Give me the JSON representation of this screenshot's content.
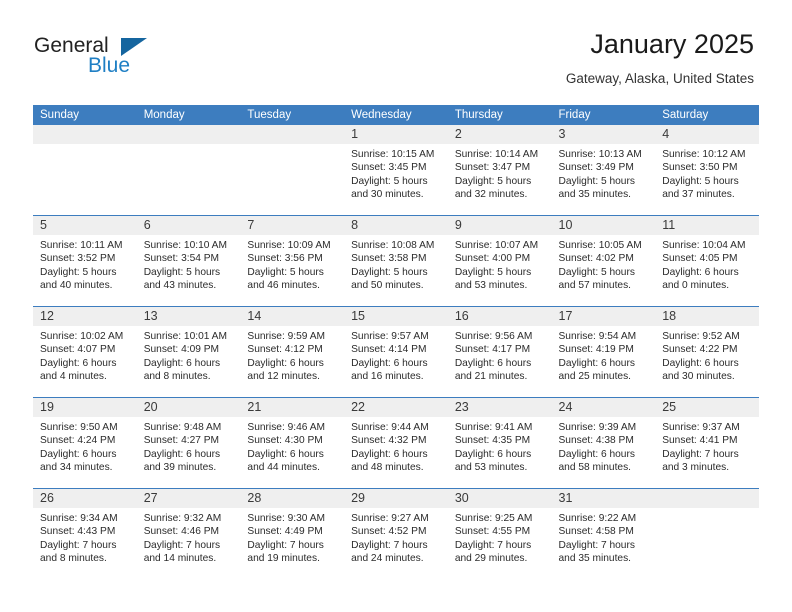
{
  "brand": {
    "line1": "General",
    "line2": "Blue",
    "triangle_color": "#15659f",
    "accent_color": "#1f7fc4"
  },
  "header": {
    "title": "January 2025",
    "subtitle": "Gateway, Alaska, United States"
  },
  "theme": {
    "header_row_bg": "#3d7dbf",
    "daynum_band_bg": "#efefef",
    "rule_color": "#3d7dbf"
  },
  "calendar": {
    "weekday_headers": [
      "Sunday",
      "Monday",
      "Tuesday",
      "Wednesday",
      "Thursday",
      "Friday",
      "Saturday"
    ],
    "weeks": [
      [
        {
          "day": "",
          "sunrise": "",
          "sunset": "",
          "daylight_line1": "",
          "daylight_line2": ""
        },
        {
          "day": "",
          "sunrise": "",
          "sunset": "",
          "daylight_line1": "",
          "daylight_line2": ""
        },
        {
          "day": "",
          "sunrise": "",
          "sunset": "",
          "daylight_line1": "",
          "daylight_line2": ""
        },
        {
          "day": "1",
          "sunrise": "Sunrise: 10:15 AM",
          "sunset": "Sunset: 3:45 PM",
          "daylight_line1": "Daylight: 5 hours",
          "daylight_line2": "and 30 minutes."
        },
        {
          "day": "2",
          "sunrise": "Sunrise: 10:14 AM",
          "sunset": "Sunset: 3:47 PM",
          "daylight_line1": "Daylight: 5 hours",
          "daylight_line2": "and 32 minutes."
        },
        {
          "day": "3",
          "sunrise": "Sunrise: 10:13 AM",
          "sunset": "Sunset: 3:49 PM",
          "daylight_line1": "Daylight: 5 hours",
          "daylight_line2": "and 35 minutes."
        },
        {
          "day": "4",
          "sunrise": "Sunrise: 10:12 AM",
          "sunset": "Sunset: 3:50 PM",
          "daylight_line1": "Daylight: 5 hours",
          "daylight_line2": "and 37 minutes."
        }
      ],
      [
        {
          "day": "5",
          "sunrise": "Sunrise: 10:11 AM",
          "sunset": "Sunset: 3:52 PM",
          "daylight_line1": "Daylight: 5 hours",
          "daylight_line2": "and 40 minutes."
        },
        {
          "day": "6",
          "sunrise": "Sunrise: 10:10 AM",
          "sunset": "Sunset: 3:54 PM",
          "daylight_line1": "Daylight: 5 hours",
          "daylight_line2": "and 43 minutes."
        },
        {
          "day": "7",
          "sunrise": "Sunrise: 10:09 AM",
          "sunset": "Sunset: 3:56 PM",
          "daylight_line1": "Daylight: 5 hours",
          "daylight_line2": "and 46 minutes."
        },
        {
          "day": "8",
          "sunrise": "Sunrise: 10:08 AM",
          "sunset": "Sunset: 3:58 PM",
          "daylight_line1": "Daylight: 5 hours",
          "daylight_line2": "and 50 minutes."
        },
        {
          "day": "9",
          "sunrise": "Sunrise: 10:07 AM",
          "sunset": "Sunset: 4:00 PM",
          "daylight_line1": "Daylight: 5 hours",
          "daylight_line2": "and 53 minutes."
        },
        {
          "day": "10",
          "sunrise": "Sunrise: 10:05 AM",
          "sunset": "Sunset: 4:02 PM",
          "daylight_line1": "Daylight: 5 hours",
          "daylight_line2": "and 57 minutes."
        },
        {
          "day": "11",
          "sunrise": "Sunrise: 10:04 AM",
          "sunset": "Sunset: 4:05 PM",
          "daylight_line1": "Daylight: 6 hours",
          "daylight_line2": "and 0 minutes."
        }
      ],
      [
        {
          "day": "12",
          "sunrise": "Sunrise: 10:02 AM",
          "sunset": "Sunset: 4:07 PM",
          "daylight_line1": "Daylight: 6 hours",
          "daylight_line2": "and 4 minutes."
        },
        {
          "day": "13",
          "sunrise": "Sunrise: 10:01 AM",
          "sunset": "Sunset: 4:09 PM",
          "daylight_line1": "Daylight: 6 hours",
          "daylight_line2": "and 8 minutes."
        },
        {
          "day": "14",
          "sunrise": "Sunrise: 9:59 AM",
          "sunset": "Sunset: 4:12 PM",
          "daylight_line1": "Daylight: 6 hours",
          "daylight_line2": "and 12 minutes."
        },
        {
          "day": "15",
          "sunrise": "Sunrise: 9:57 AM",
          "sunset": "Sunset: 4:14 PM",
          "daylight_line1": "Daylight: 6 hours",
          "daylight_line2": "and 16 minutes."
        },
        {
          "day": "16",
          "sunrise": "Sunrise: 9:56 AM",
          "sunset": "Sunset: 4:17 PM",
          "daylight_line1": "Daylight: 6 hours",
          "daylight_line2": "and 21 minutes."
        },
        {
          "day": "17",
          "sunrise": "Sunrise: 9:54 AM",
          "sunset": "Sunset: 4:19 PM",
          "daylight_line1": "Daylight: 6 hours",
          "daylight_line2": "and 25 minutes."
        },
        {
          "day": "18",
          "sunrise": "Sunrise: 9:52 AM",
          "sunset": "Sunset: 4:22 PM",
          "daylight_line1": "Daylight: 6 hours",
          "daylight_line2": "and 30 minutes."
        }
      ],
      [
        {
          "day": "19",
          "sunrise": "Sunrise: 9:50 AM",
          "sunset": "Sunset: 4:24 PM",
          "daylight_line1": "Daylight: 6 hours",
          "daylight_line2": "and 34 minutes."
        },
        {
          "day": "20",
          "sunrise": "Sunrise: 9:48 AM",
          "sunset": "Sunset: 4:27 PM",
          "daylight_line1": "Daylight: 6 hours",
          "daylight_line2": "and 39 minutes."
        },
        {
          "day": "21",
          "sunrise": "Sunrise: 9:46 AM",
          "sunset": "Sunset: 4:30 PM",
          "daylight_line1": "Daylight: 6 hours",
          "daylight_line2": "and 44 minutes."
        },
        {
          "day": "22",
          "sunrise": "Sunrise: 9:44 AM",
          "sunset": "Sunset: 4:32 PM",
          "daylight_line1": "Daylight: 6 hours",
          "daylight_line2": "and 48 minutes."
        },
        {
          "day": "23",
          "sunrise": "Sunrise: 9:41 AM",
          "sunset": "Sunset: 4:35 PM",
          "daylight_line1": "Daylight: 6 hours",
          "daylight_line2": "and 53 minutes."
        },
        {
          "day": "24",
          "sunrise": "Sunrise: 9:39 AM",
          "sunset": "Sunset: 4:38 PM",
          "daylight_line1": "Daylight: 6 hours",
          "daylight_line2": "and 58 minutes."
        },
        {
          "day": "25",
          "sunrise": "Sunrise: 9:37 AM",
          "sunset": "Sunset: 4:41 PM",
          "daylight_line1": "Daylight: 7 hours",
          "daylight_line2": "and 3 minutes."
        }
      ],
      [
        {
          "day": "26",
          "sunrise": "Sunrise: 9:34 AM",
          "sunset": "Sunset: 4:43 PM",
          "daylight_line1": "Daylight: 7 hours",
          "daylight_line2": "and 8 minutes."
        },
        {
          "day": "27",
          "sunrise": "Sunrise: 9:32 AM",
          "sunset": "Sunset: 4:46 PM",
          "daylight_line1": "Daylight: 7 hours",
          "daylight_line2": "and 14 minutes."
        },
        {
          "day": "28",
          "sunrise": "Sunrise: 9:30 AM",
          "sunset": "Sunset: 4:49 PM",
          "daylight_line1": "Daylight: 7 hours",
          "daylight_line2": "and 19 minutes."
        },
        {
          "day": "29",
          "sunrise": "Sunrise: 9:27 AM",
          "sunset": "Sunset: 4:52 PM",
          "daylight_line1": "Daylight: 7 hours",
          "daylight_line2": "and 24 minutes."
        },
        {
          "day": "30",
          "sunrise": "Sunrise: 9:25 AM",
          "sunset": "Sunset: 4:55 PM",
          "daylight_line1": "Daylight: 7 hours",
          "daylight_line2": "and 29 minutes."
        },
        {
          "day": "31",
          "sunrise": "Sunrise: 9:22 AM",
          "sunset": "Sunset: 4:58 PM",
          "daylight_line1": "Daylight: 7 hours",
          "daylight_line2": "and 35 minutes."
        },
        {
          "day": "",
          "sunrise": "",
          "sunset": "",
          "daylight_line1": "",
          "daylight_line2": ""
        }
      ]
    ]
  }
}
